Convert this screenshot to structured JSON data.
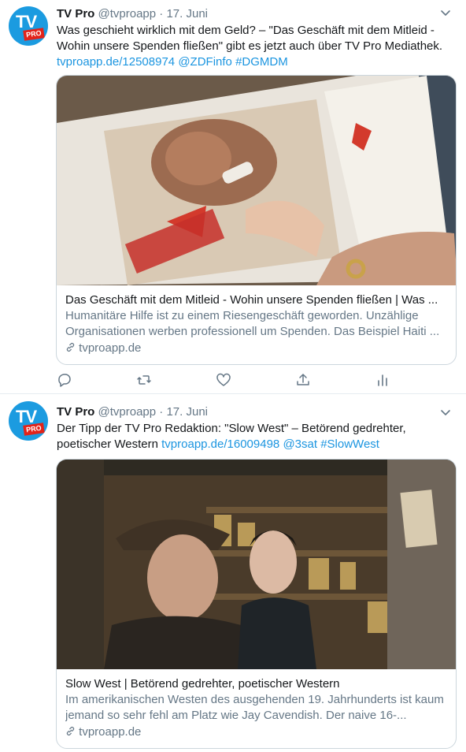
{
  "tweets": [
    {
      "name": "TV Pro",
      "handle": "@tvproapp",
      "dot": "·",
      "date": "17. Juni",
      "avatar_text": "TV",
      "avatar_badge": "PRO",
      "text_plain": "Was geschieht wirklich mit dem Geld? – \"Das Geschäft mit dem Mitleid - Wohin unsere Spenden fließen\" gibt es jetzt auch über TV Pro Mediathek.",
      "links": [
        "tvproapp.de/12508974",
        "@ZDFinfo",
        "#DGMDM"
      ],
      "card": {
        "title": "Das Geschäft mit dem Mitleid - Wohin unsere Spenden fließen | Was ...",
        "description": "Humanitäre Hilfe ist zu einem Riesengeschäft geworden. Unzählige Organisationen werben professionell um Spenden. Das Beispiel Haiti ...",
        "domain": "tvproapp.de"
      }
    },
    {
      "name": "TV Pro",
      "handle": "@tvproapp",
      "dot": "·",
      "date": "17. Juni",
      "avatar_text": "TV",
      "avatar_badge": "PRO",
      "text_plain": "Der Tipp der TV Pro Redaktion: \"Slow West\" – Betörend gedrehter, poetischer Western",
      "links": [
        "tvproapp.de/16009498",
        "@3sat",
        "#SlowWest"
      ],
      "card": {
        "title": "Slow West | Betörend gedrehter, poetischer Western",
        "description": "Im amerikanischen Westen des ausgehenden 19. Jahrhunderts ist kaum jemand so sehr fehl am Platz wie Jay Cavendish. Der naive 16-...",
        "domain": "tvproapp.de"
      }
    }
  ],
  "icons": {
    "reply": "reply-icon",
    "retweet": "retweet-icon",
    "like": "like-icon",
    "share": "share-icon",
    "analytics": "analytics-icon",
    "more": "chevron-down-icon",
    "link": "link-icon"
  },
  "colors": {
    "link": "#1b95e0",
    "secondary": "#657786",
    "border": "#ccd6dd",
    "avatar_blue": "#1b9be0",
    "avatar_red": "#e2231a"
  }
}
